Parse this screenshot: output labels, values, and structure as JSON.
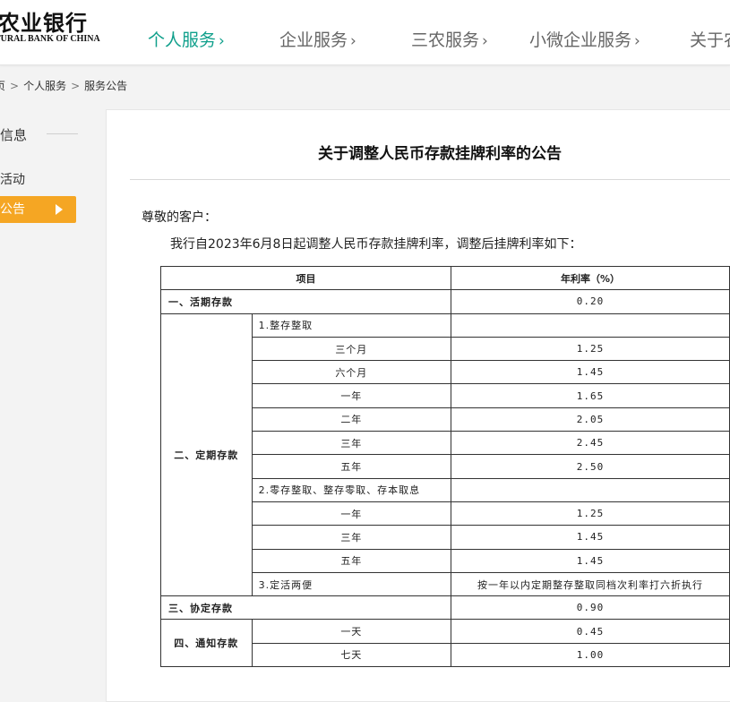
{
  "header": {
    "logo_cn": "农业银行",
    "logo_en": "TURAL BANK OF CHINA",
    "nav": [
      {
        "label": "个人服务",
        "chev": "›"
      },
      {
        "label": "企业服务",
        "chev": "›"
      },
      {
        "label": "三农服务",
        "chev": "›"
      },
      {
        "label": "小微企业服务",
        "chev": "›"
      },
      {
        "label": "关于农"
      }
    ],
    "accent_color": "#0f9f8b"
  },
  "breadcrumb": [
    "页",
    "个人服务",
    "服务公告"
  ],
  "sidebar": {
    "title": "信息",
    "items": [
      {
        "label": "活动"
      },
      {
        "label": "公告",
        "active": true
      }
    ],
    "active_color": "#f5a623"
  },
  "article": {
    "title": "关于调整人民币存款挂牌利率的公告",
    "greeting": "尊敬的客户：",
    "intro": "我行自2023年6月8日起调整人民币存款挂牌利率，调整后挂牌利率如下：",
    "table": {
      "header_item": "项目",
      "header_rate": "年利率（%）",
      "demand": {
        "label": "一、活期存款",
        "rate": "0.20"
      },
      "time": {
        "label": "二、定期存款",
        "lump": {
          "label": "1.整存整取",
          "terms": [
            {
              "term": "三个月",
              "rate": "1.25"
            },
            {
              "term": "六个月",
              "rate": "1.45"
            },
            {
              "term": "一年",
              "rate": "1.65"
            },
            {
              "term": "二年",
              "rate": "2.05"
            },
            {
              "term": "三年",
              "rate": "2.45"
            },
            {
              "term": "五年",
              "rate": "2.50"
            }
          ]
        },
        "installment": {
          "label": "2.零存整取、整存零取、存本取息",
          "terms": [
            {
              "term": "一年",
              "rate": "1.25"
            },
            {
              "term": "三年",
              "rate": "1.45"
            },
            {
              "term": "五年",
              "rate": "1.45"
            }
          ]
        },
        "flexible": {
          "label": "3.定活两便",
          "note": "按一年以内定期整存整取同档次利率打六折执行"
        }
      },
      "agreement": {
        "label": "三、协定存款",
        "rate": "0.90"
      },
      "notice": {
        "label": "四、通知存款",
        "terms": [
          {
            "term": "一天",
            "rate": "0.45"
          },
          {
            "term": "七天",
            "rate": "1.00"
          }
        ]
      }
    }
  }
}
